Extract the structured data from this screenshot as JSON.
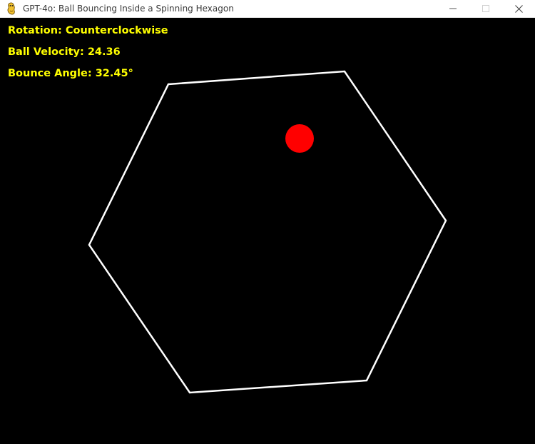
{
  "window": {
    "title": "GPT-4o: Ball Bouncing Inside a Spinning Hexagon",
    "app_icon": "pygame-snake-icon",
    "controls": {
      "minimize_icon": "minimize-icon",
      "maximize_icon": "maximize-icon",
      "close_icon": "close-icon"
    }
  },
  "hud": {
    "rotation": "Rotation: Counterclockwise",
    "velocity": "Ball Velocity: 24.36",
    "angle": "Bounce Angle: 32.45°"
  },
  "scene": {
    "background_color": "#000000",
    "hexagon_color": "#ffffff",
    "ball_color": "#ff0000",
    "hud_color": "#ffff00"
  }
}
